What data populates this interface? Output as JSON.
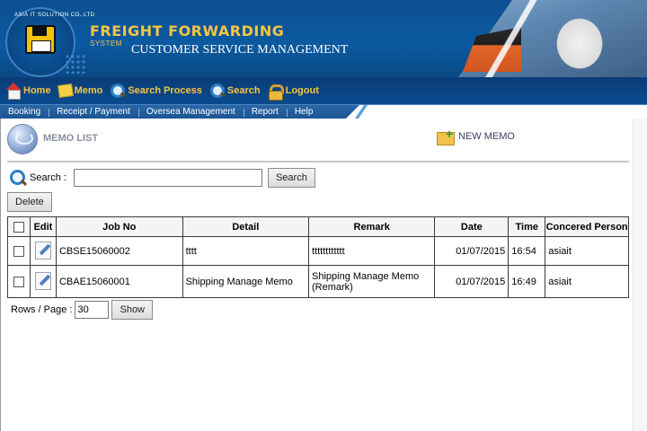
{
  "banner": {
    "logo_text": "ASIA IT SOLUTION CO.,LTD",
    "title_line1": "FREIGHT FORWARDING",
    "title_line2": "SYSTEM",
    "title_line3": "CUSTOMER SERVICE MANAGEMENT"
  },
  "main_nav": {
    "items": [
      {
        "label": "Home",
        "icon": "home-icon"
      },
      {
        "label": "Memo",
        "icon": "memo-icon"
      },
      {
        "label": "Search Process",
        "icon": "search-icon"
      },
      {
        "label": "Search",
        "icon": "search-icon"
      },
      {
        "label": "Logout",
        "icon": "lock-icon"
      }
    ]
  },
  "sub_nav": {
    "items": [
      "Booking",
      "Receipt / Payment",
      "Oversea Management",
      "Report",
      "Help"
    ]
  },
  "page": {
    "title": "MEMO LIST",
    "new_memo_label": "NEW MEMO"
  },
  "search": {
    "label": "Search :",
    "value": "",
    "button_label": "Search"
  },
  "delete_label": "Delete",
  "table": {
    "headers": {
      "edit": "Edit",
      "job_no": "Job No",
      "detail": "Detail",
      "remark": "Remark",
      "date": "Date",
      "time": "Time",
      "person": "Concered Person"
    },
    "rows": [
      {
        "job_no": "CBSE15060002",
        "detail": "tttt",
        "remark": "tttttttttttt",
        "date": "01/07/2015",
        "time": "16:54",
        "person": "asiait"
      },
      {
        "job_no": "CBAE15060001",
        "detail": "Shipping Manage Memo",
        "remark": "Shipping Manage Memo (Remark)",
        "date": "01/07/2015",
        "time": "16:49",
        "person": "asiait"
      }
    ]
  },
  "pager": {
    "label": "Rows / Page :",
    "value": "30",
    "button_label": "Show"
  }
}
